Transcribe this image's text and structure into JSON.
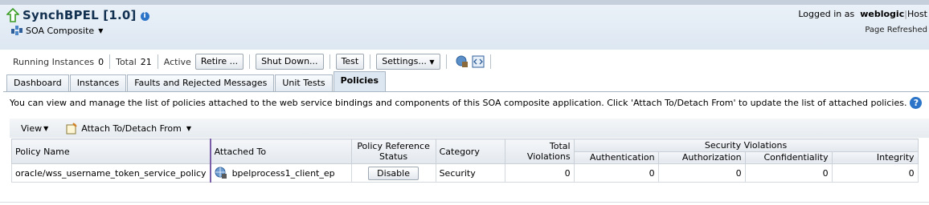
{
  "header": {
    "title": "SynchBPEL [1.0]",
    "composite_menu": "SOA Composite",
    "logged_in_label": "Logged in as",
    "user": "weblogic",
    "host_link": "Host",
    "page_refreshed": "Page Refreshed"
  },
  "toolbar": {
    "running_label": "Running Instances",
    "running_value": "0",
    "total_label": "Total",
    "total_value": "21",
    "active_label": "Active",
    "retire_label": "Retire ...",
    "shutdown_label": "Shut Down...",
    "test_label": "Test",
    "settings_label": "Settings..."
  },
  "tabs": [
    "Dashboard",
    "Instances",
    "Faults and Rejected Messages",
    "Unit Tests",
    "Policies"
  ],
  "active_tab": "Policies",
  "description": "You can view and manage the list of policies attached to the web service bindings and components of this SOA composite application. Click 'Attach To/Detach From' to update the list of attached policies.",
  "panel_toolbar": {
    "view_label": "View",
    "attach_label": "Attach To/Detach From"
  },
  "table": {
    "headers": {
      "policy_name": "Policy Name",
      "attached_to": "Attached To",
      "policy_ref_status": "Policy Reference Status",
      "category": "Category",
      "total_violations": "Total Violations",
      "security_violations": "Security Violations",
      "authentication": "Authentication",
      "authorization": "Authorization",
      "confidentiality": "Confidentiality",
      "integrity": "Integrity"
    },
    "rows": [
      {
        "policy_name": "oracle/wss_username_token_service_policy",
        "attached_to": "bpelprocess1_client_ep",
        "status_button": "Disable",
        "category": "Security",
        "total_violations": "0",
        "authentication": "0",
        "authorization": "0",
        "confidentiality": "0",
        "integrity": "0"
      }
    ]
  },
  "icons": {
    "status": "up-arrow-icon",
    "info": "info-icon",
    "composite": "composite-icon",
    "help": "help-icon",
    "attach": "attach-detach-icon",
    "endpoint": "web-service-icon"
  },
  "colors": {
    "header_bg": "#dde7f2",
    "title_color": "#12304f",
    "status_up": "#3a9d23",
    "help_blue": "#2c74c7"
  }
}
